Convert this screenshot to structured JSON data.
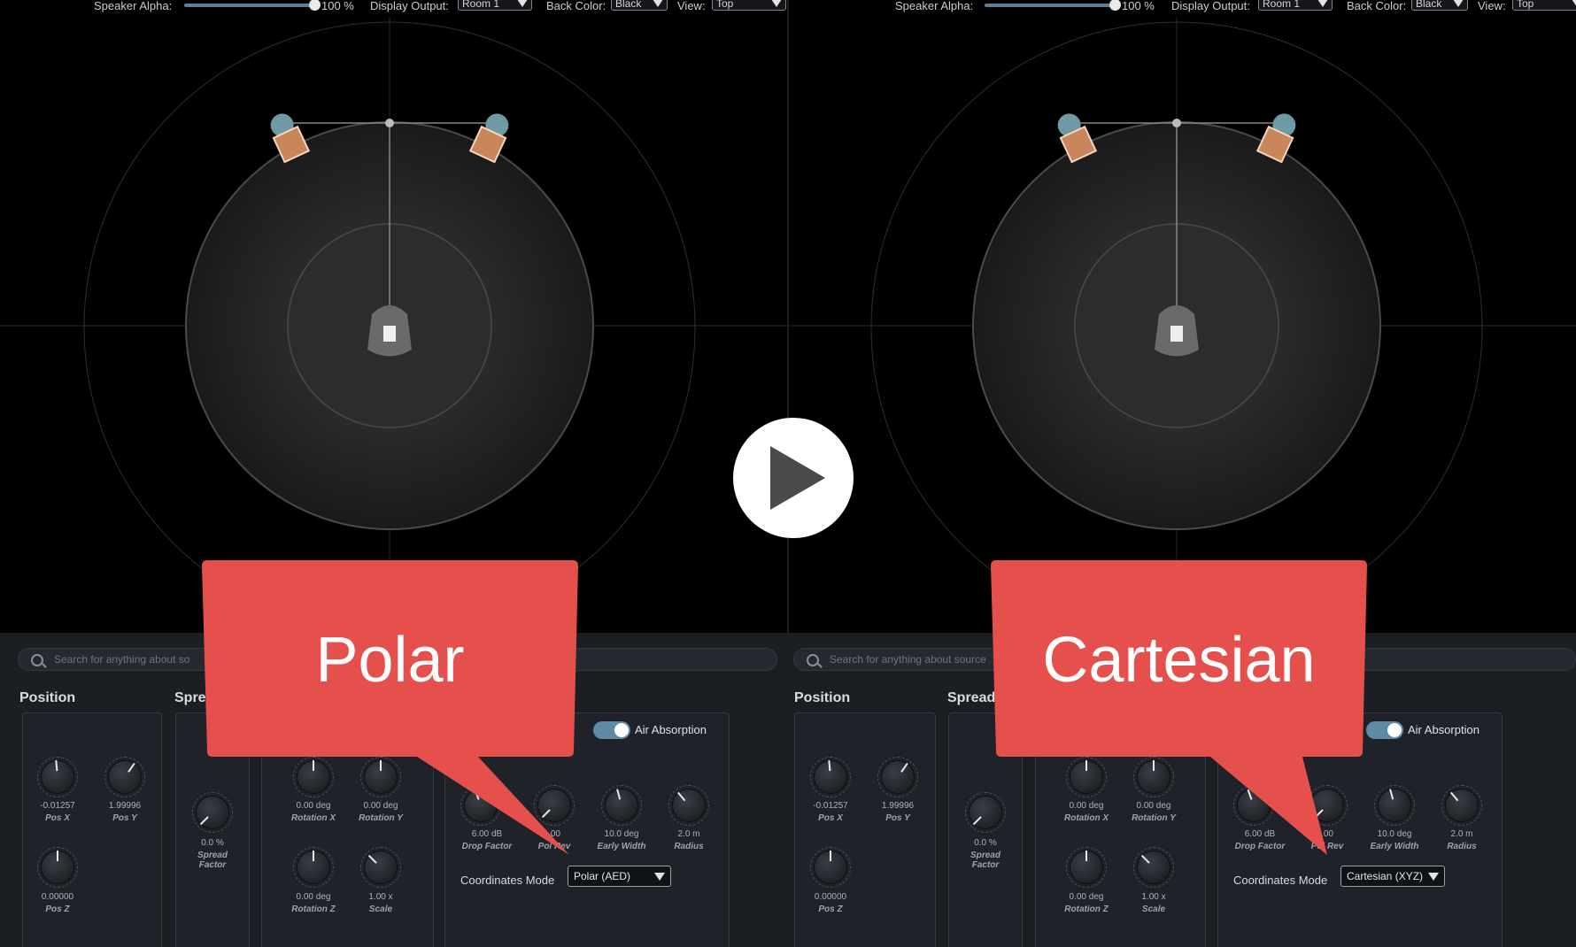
{
  "top_bar": {
    "speaker_alpha_label": "Speaker Alpha:",
    "speaker_alpha_value": "100 %",
    "speaker_alpha_fraction": 1.0,
    "display_output_label": "Display Output:",
    "display_output_value": "Room 1",
    "back_color_label": "Back Color:",
    "back_color_value": "Black",
    "view_label": "View:",
    "view_value": "Top"
  },
  "search": {
    "left_placeholder": "Search for anything about so",
    "right_placeholder": "Search for anything about source"
  },
  "sections": {
    "position": "Position",
    "spread_partial": "Spre",
    "spread": "Spread"
  },
  "knobs": {
    "pos_x": {
      "value": "-0.01257",
      "name": "Pos X"
    },
    "pos_y": {
      "value": "1.99996",
      "name": "Pos Y"
    },
    "pos_z": {
      "value": "0.00000",
      "name": "Pos Z"
    },
    "spread_factor": {
      "value": "0.0 %",
      "name": "Spread Factor"
    },
    "rotation_x": {
      "value": "0.00 deg",
      "name": "Rotation X"
    },
    "rotation_y": {
      "value": "0.00 deg",
      "name": "Rotation Y"
    },
    "rotation_z": {
      "value": "0.00 deg",
      "name": "Rotation Z"
    },
    "scale": {
      "value": "1.00 x",
      "name": "Scale"
    },
    "drop_factor": {
      "value": "6.00 dB",
      "name": "Drop Factor"
    },
    "pol_rev": {
      "value": ".00",
      "name": "Pol Rev"
    },
    "early_width": {
      "value": "10.0 deg",
      "name": "Early Width"
    },
    "radius": {
      "value": "2.0 m",
      "name": "Radius"
    }
  },
  "air_absorption": {
    "label": "Air Absorption",
    "enabled": true
  },
  "coordinates": {
    "label": "Coordinates Mode",
    "left_value": "Polar (AED)",
    "right_value": "Cartesian (XYZ)"
  },
  "callouts": {
    "left": "Polar",
    "right": "Cartesian"
  },
  "colors": {
    "callout": "#e5504c",
    "accent": "#5e8aa6",
    "background": "#000000"
  },
  "icons": {
    "play": "play-icon",
    "search": "search-icon",
    "speaker": "speaker-icon",
    "listener": "listener-head-icon"
  }
}
